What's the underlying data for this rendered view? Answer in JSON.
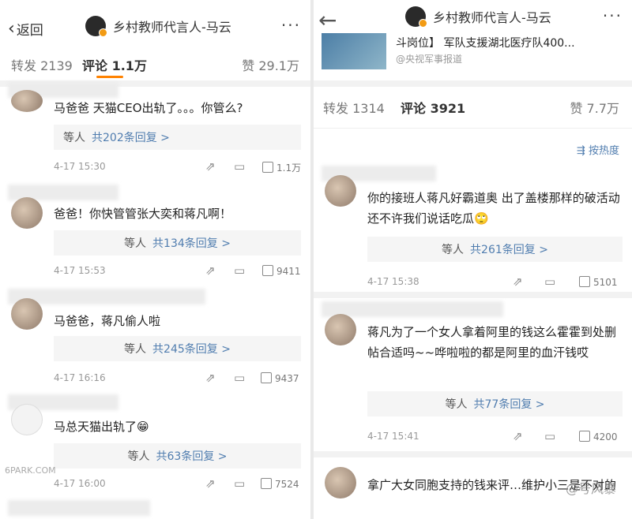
{
  "left": {
    "back_label": "返回",
    "account_name": "乡村教师代言人-马云",
    "more_label": "···",
    "tabs": {
      "repost_label": "转发",
      "repost_count": "2139",
      "comment_label": "评论",
      "comment_count": "1.1万",
      "like_label": "赞",
      "like_count": "29.1万"
    },
    "comments": [
      {
        "text": "马爸爸  天猫CEO出轨了。。。你管么?",
        "reply_who": "等人",
        "reply_count": "共202条回复 >",
        "date": "4-17 15:30",
        "likes": "1.1万"
      },
      {
        "text": "爸爸！你快管管张大奕和蒋凡啊！",
        "reply_who": "等人",
        "reply_count": "共134条回复 >",
        "date": "4-17 15:53",
        "likes": "9411"
      },
      {
        "text": "马爸爸，蒋凡偷人啦",
        "reply_who": "等人",
        "reply_count": "共245条回复 >",
        "date": "4-17 16:16",
        "likes": "9437"
      },
      {
        "text": "马总天猫出轨了😁",
        "reply_who": "等人",
        "reply_count": "共63条回复 >",
        "date": "4-17 16:00",
        "likes": "7524"
      }
    ],
    "watermark": "6PARK.COM"
  },
  "right": {
    "account_name": "乡村教师代言人-马云",
    "more_label": "···",
    "news_headline": "斗岗位】 军队支援湖北医疗队400...",
    "news_source": "@央视军事报道",
    "tabs": {
      "repost_label": "转发",
      "repost_count": "1314",
      "comment_label": "评论",
      "comment_count": "3921",
      "like_label": "赞",
      "like_count": "7.7万"
    },
    "sort_label": "按热度",
    "comments": [
      {
        "text": "你的接班人蒋凡好霸道奥 出了盖楼那样的破活动还不许我们说话吃瓜🙄",
        "reply_who": "等人",
        "reply_count": "共261条回复 >",
        "date": "4-17 15:38",
        "likes": "5101"
      },
      {
        "text": "蒋凡为了一个女人拿着阿里的钱这么霍霍到处删帖合适吗~~哗啦啦的都是阿里的血汗钱哎",
        "reply_who": "等人",
        "reply_count": "共77条回复 >",
        "date": "4-17 15:41",
        "likes": "4200"
      },
      {
        "text": "拿广大女同胞支持的钱来评…维护小三是不对的"
      }
    ],
    "watermark": "@号风暴"
  }
}
